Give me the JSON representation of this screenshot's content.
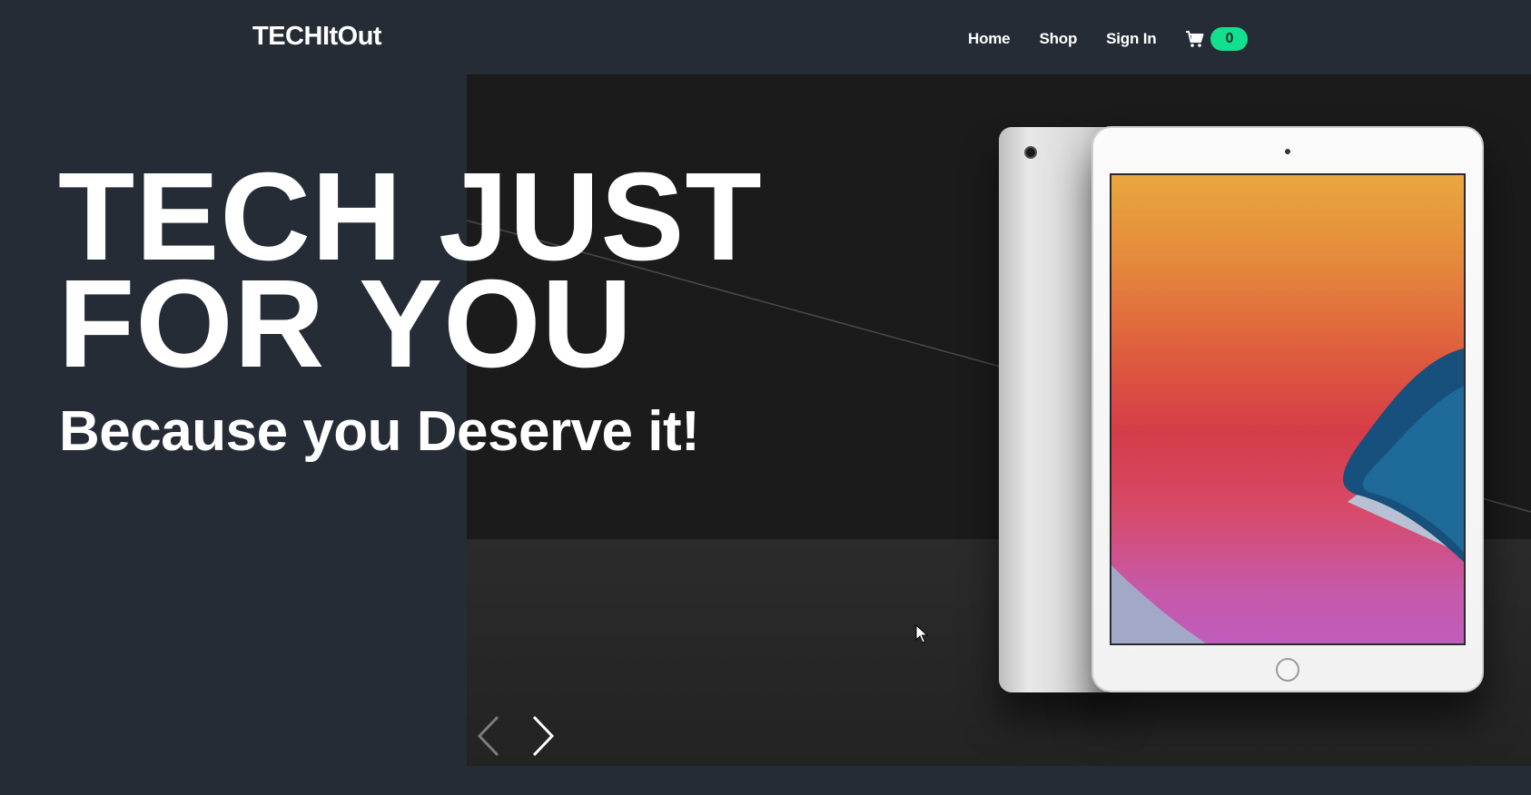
{
  "header": {
    "brand": "TECHItOut",
    "nav": [
      {
        "label": "Home"
      },
      {
        "label": "Shop"
      },
      {
        "label": "Sign In"
      }
    ],
    "cart": {
      "icon": "cart-icon",
      "count": "0",
      "badge_color": "#13e08f"
    }
  },
  "hero": {
    "headline_line1": "TECH JUST",
    "headline_line2": "FOR YOU",
    "subline": "Because you Deserve it!",
    "carousel": {
      "prev_icon": "chevron-left-icon",
      "next_icon": "chevron-right-icon"
    }
  },
  "colors": {
    "background": "#262c36",
    "text": "#ffffff",
    "accent": "#13e08f"
  }
}
